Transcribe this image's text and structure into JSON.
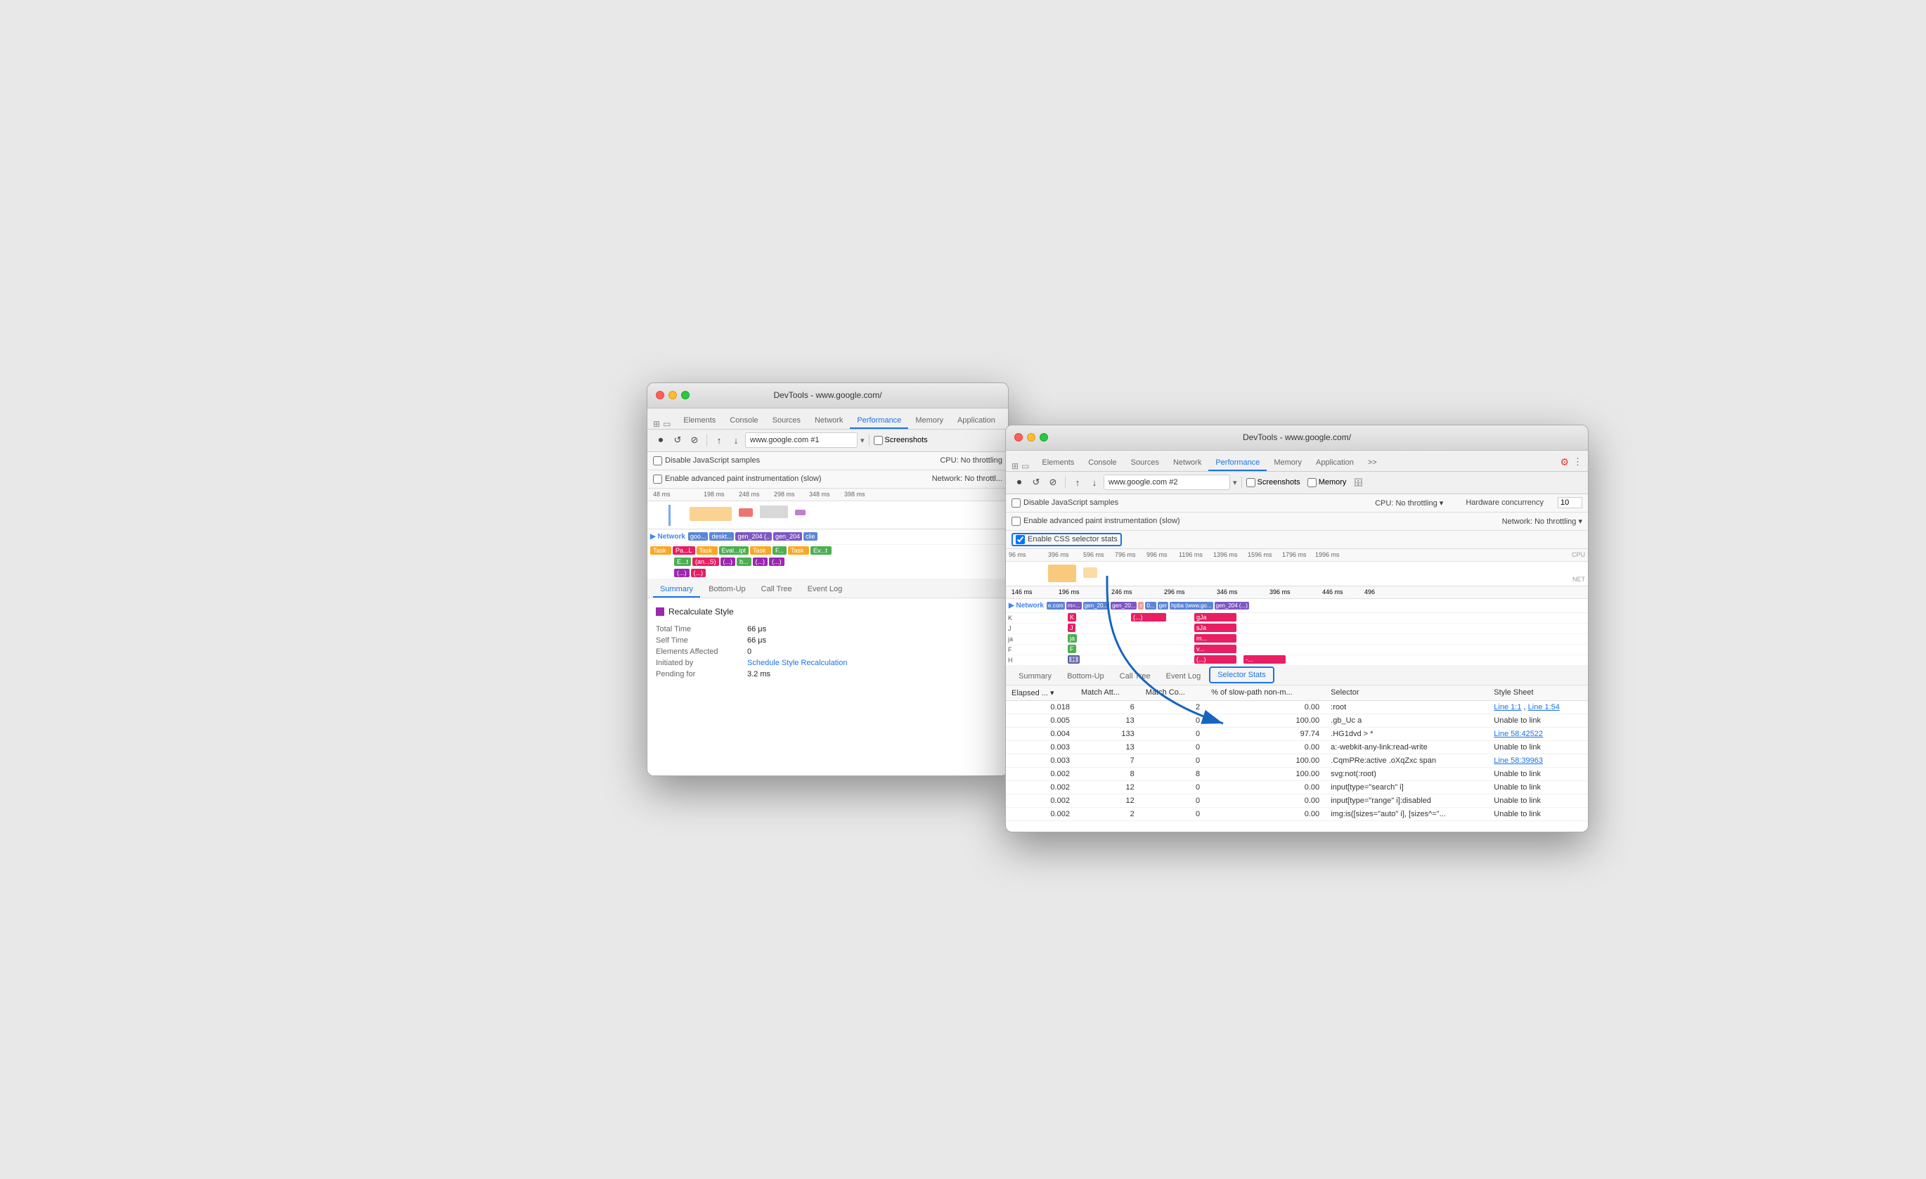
{
  "window1": {
    "title": "DevTools - www.google.com/",
    "tabs": [
      "Elements",
      "Console",
      "Sources",
      "Network",
      "Performance",
      "Memory",
      "Application",
      ">>"
    ],
    "active_tab": "Performance",
    "url": "www.google.com #1",
    "toolbar_icons": [
      "record",
      "reload",
      "clear",
      "upload",
      "download"
    ],
    "checkboxes": [
      {
        "label": "Disable JavaScript samples",
        "checked": false
      },
      {
        "label": "Enable advanced paint instrumentation (slow)",
        "checked": false
      }
    ],
    "cpu_label": "CPU:",
    "cpu_value": "No throttling",
    "network_label": "Network:",
    "network_value": "No throttl...",
    "ruler_ticks": [
      "48 ms",
      "198 ms",
      "248 ms",
      "298 ms",
      "348 ms",
      "398 ms"
    ],
    "tracks": [
      {
        "label": "Network",
        "blocks": [
          "goo...",
          "deskt...",
          "gen_204 (..)",
          "gen_204",
          "clie"
        ]
      },
      {
        "label": "",
        "blocks": [
          "Task",
          "Pa...L",
          "Task",
          "Eval...ipt",
          "Task",
          "F...",
          "Task",
          "Ev...t"
        ]
      },
      {
        "label": "",
        "blocks": [
          "E...t",
          "(an...S)",
          "(...)",
          "b...",
          "(...)",
          "(...)"
        ]
      },
      {
        "label": "",
        "blocks": [
          "(...)",
          "(...)"
        ]
      }
    ],
    "bottom_tabs": [
      "Summary",
      "Bottom-Up",
      "Call Tree",
      "Event Log"
    ],
    "active_bottom_tab": "Summary",
    "summary": {
      "title": "Recalculate Style",
      "color": "#9c27b0",
      "rows": [
        {
          "label": "Total Time",
          "value": "66 μs"
        },
        {
          "label": "Self Time",
          "value": "66 μs"
        },
        {
          "label": "Elements Affected",
          "value": "0"
        },
        {
          "label": "Initiated by",
          "value": "Schedule Style Recalculation",
          "is_link": true
        },
        {
          "label": "Pending for",
          "value": "3.2 ms"
        }
      ]
    }
  },
  "window2": {
    "title": "DevTools - www.google.com/",
    "tabs": [
      "Elements",
      "Console",
      "Sources",
      "Network",
      "Performance",
      "Memory",
      "Application",
      ">>"
    ],
    "active_tab": "Performance",
    "url": "www.google.com #2",
    "toolbar_icons": [
      "record",
      "reload",
      "clear",
      "upload",
      "download"
    ],
    "screenshots_label": "Screenshots",
    "memory_label": "Memory",
    "hardware_concurrency_label": "Hardware concurrency",
    "hardware_concurrency_value": "10",
    "checkboxes": [
      {
        "label": "Disable JavaScript samples",
        "checked": false
      },
      {
        "label": "Enable advanced paint instrumentation (slow)",
        "checked": false
      },
      {
        "label": "Enable CSS selector stats",
        "checked": true
      }
    ],
    "cpu_label": "CPU:",
    "cpu_value": "No throttling",
    "network_label": "Network:",
    "network_value": "No throttling",
    "ruler_ticks": [
      "96 ms",
      "396 ms",
      "596 ms",
      "796 ms",
      "996 ms",
      "1196 ms",
      "1396 ms",
      "1596 ms",
      "1796 ms",
      "1996 ms"
    ],
    "side_labels": [
      "CPU",
      "NET"
    ],
    "timeline_tracks": [
      {
        "label": "Network",
        "segments": [
          "e.com",
          "m=...",
          "gen_20...",
          "gen_20...",
          "c",
          "0...",
          "ger",
          "hpba (www.go...",
          "gen_204 (...)"
        ]
      }
    ],
    "flame_rows": [
      {
        "label": "K",
        "color": "#e91e63"
      },
      {
        "label": "J",
        "color": "#e91e63"
      },
      {
        "label": "ja",
        "color": "#e91e63"
      },
      {
        "label": "F",
        "color": "#e91e63"
      },
      {
        "label": "H",
        "color": "#e91e63"
      }
    ],
    "right_blocks": [
      {
        "labels": [
          "(...)",
          "gJa",
          "sJa",
          "m...",
          "v...",
          "(.."
        ]
      },
      {
        "labels": [
          "-..."
        ]
      }
    ],
    "bottom_tabs": [
      "Summary",
      "Bottom-Up",
      "Call Tree",
      "Event Log",
      "Selector Stats"
    ],
    "active_bottom_tab": "Selector Stats",
    "table": {
      "headers": [
        "Elapsed ...",
        "Match Att...",
        "Match Co...",
        "% of slow-path non-m...",
        "Selector",
        "Style Sheet"
      ],
      "rows": [
        {
          "elapsed": "0.018",
          "match_att": "6",
          "match_co": "2",
          "slow_path": "0.00",
          "selector": ":root",
          "style_sheet": "Line 1:1 , Line 1:54",
          "style_sheet_link": true
        },
        {
          "elapsed": "0.005",
          "match_att": "13",
          "match_co": "0",
          "slow_path": "100.00",
          "selector": ".gb_Uc a",
          "style_sheet": "Unable to link"
        },
        {
          "elapsed": "0.004",
          "match_att": "133",
          "match_co": "0",
          "slow_path": "97.74",
          "selector": ".HG1dvd > *",
          "style_sheet": "Line 58:42522",
          "style_sheet_link": true
        },
        {
          "elapsed": "0.003",
          "match_att": "13",
          "match_co": "0",
          "slow_path": "0.00",
          "selector": "a:-webkit-any-link:read-write",
          "style_sheet": "Unable to link"
        },
        {
          "elapsed": "0.003",
          "match_att": "7",
          "match_co": "0",
          "slow_path": "100.00",
          "selector": ".CqmPRe:active .oXqZxc span",
          "style_sheet": "Line 58:39963",
          "style_sheet_link": true
        },
        {
          "elapsed": "0.002",
          "match_att": "8",
          "match_co": "8",
          "slow_path": "100.00",
          "selector": "svg:not(:root)",
          "style_sheet": "Unable to link"
        },
        {
          "elapsed": "0.002",
          "match_att": "12",
          "match_co": "0",
          "slow_path": "0.00",
          "selector": "input[type=\"search\" i]",
          "style_sheet": "Unable to link"
        },
        {
          "elapsed": "0.002",
          "match_att": "12",
          "match_co": "0",
          "slow_path": "0.00",
          "selector": "input[type=\"range\" i]:disabled",
          "style_sheet": "Unable to link"
        },
        {
          "elapsed": "0.002",
          "match_att": "2",
          "match_co": "0",
          "slow_path": "0.00",
          "selector": "img:is([sizes=\"auto\" i], [sizes^=\"...",
          "style_sheet": "Unable to link"
        }
      ]
    }
  },
  "arrow": {
    "description": "Blue arrow pointing from Enable CSS selector stats checkbox to Selector Stats tab"
  }
}
